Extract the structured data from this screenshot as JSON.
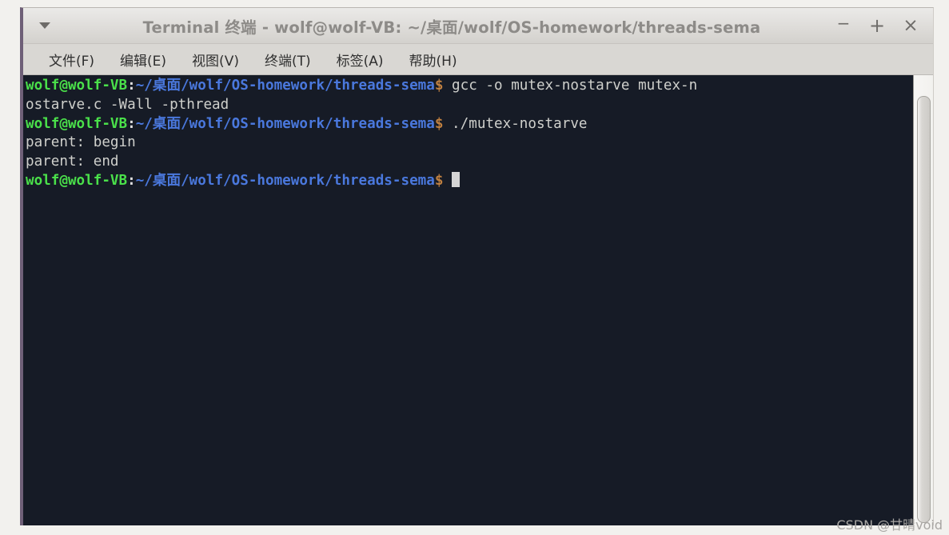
{
  "window": {
    "title": "Terminal 终端 - wolf@wolf-VB: ~/桌面/wolf/OS-homework/threads-sema",
    "menu_arrow_icon": "chevron-down-icon",
    "controls": {
      "minimize": "−",
      "maximize": "+",
      "close": "×"
    }
  },
  "menubar": {
    "items": [
      {
        "label": "文件(F)"
      },
      {
        "label": "编辑(E)"
      },
      {
        "label": "视图(V)"
      },
      {
        "label": "终端(T)"
      },
      {
        "label": "标签(A)"
      },
      {
        "label": "帮助(H)"
      }
    ]
  },
  "terminal": {
    "user_host": "wolf@wolf-VB",
    "path": "~/桌面/wolf/OS-homework/threads-sema",
    "prompt_symbol": "$",
    "colors": {
      "background": "#161b26",
      "user_host": "#4ae04a",
      "path": "#4a78dd",
      "dollar": "#c08040",
      "output": "#cfd0cc",
      "cursor": "#d5d5d5"
    },
    "lines": [
      {
        "type": "prompt",
        "command": " gcc -o mutex-nostarve mutex-n"
      },
      {
        "type": "output",
        "text": "ostarve.c -Wall -pthread"
      },
      {
        "type": "prompt",
        "command": " ./mutex-nostarve"
      },
      {
        "type": "output",
        "text": "parent: begin"
      },
      {
        "type": "output",
        "text": "parent: end"
      },
      {
        "type": "prompt-cursor",
        "command": " "
      }
    ]
  },
  "scrollbar": {
    "name": "vertical-scrollbar"
  },
  "watermark": {
    "text": "CSDN @甘晴void"
  }
}
